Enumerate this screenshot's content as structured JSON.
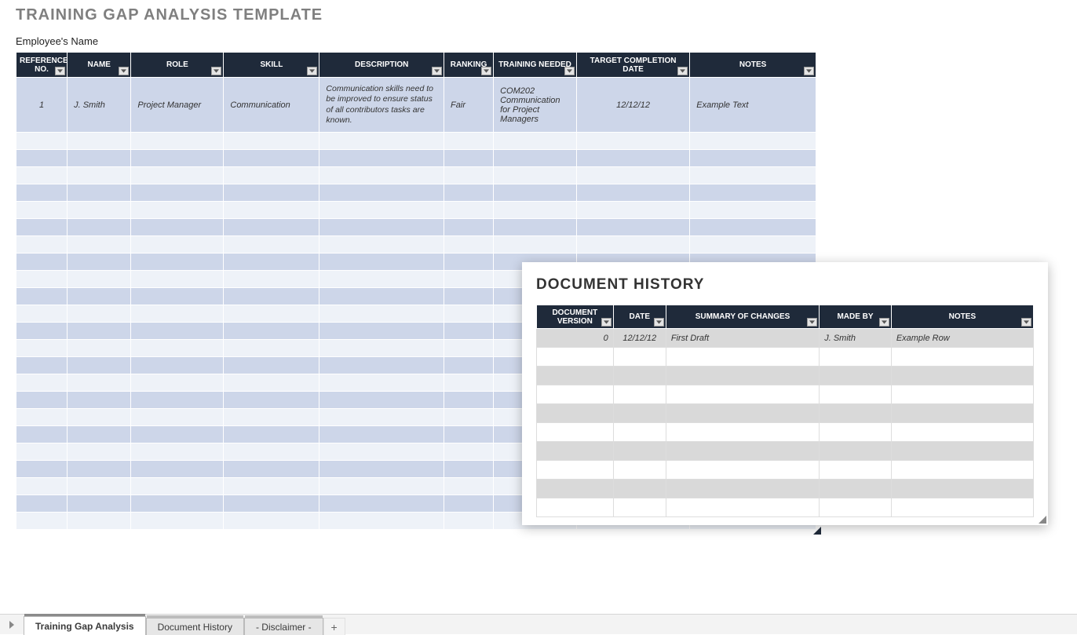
{
  "main": {
    "title": "TRAINING GAP ANALYSIS TEMPLATE",
    "subtitle": "Employee's Name",
    "headers": {
      "ref": "REFERENCE NO.",
      "name": "NAME",
      "role": "ROLE",
      "skill": "SKILL",
      "desc": "DESCRIPTION",
      "rank": "RANKING",
      "train": "TRAINING NEEDED",
      "date": "TARGET COMPLETION DATE",
      "notes": "NOTES"
    },
    "row": {
      "ref": "1",
      "name": "J. Smith",
      "role": "Project Manager",
      "skill": "Communication",
      "desc": "Communication skills need to be improved to ensure status of all contributors tasks are known.",
      "rank": "Fair",
      "train": "COM202 Communication for Project Managers",
      "date": "12/12/12",
      "notes": "Example Text"
    },
    "empty_rows": 23
  },
  "history": {
    "title": "DOCUMENT HISTORY",
    "headers": {
      "ver": "DOCUMENT VERSION",
      "date": "DATE",
      "sum": "SUMMARY OF CHANGES",
      "made": "MADE BY",
      "notes": "NOTES"
    },
    "row": {
      "ver": "0",
      "date": "12/12/12",
      "sum": "First Draft",
      "made": "J. Smith",
      "notes": "Example Row"
    },
    "empty_rows": 9
  },
  "tabs": {
    "t1": "Training Gap Analysis",
    "t2": "Document History",
    "t3": "- Disclaimer -"
  }
}
